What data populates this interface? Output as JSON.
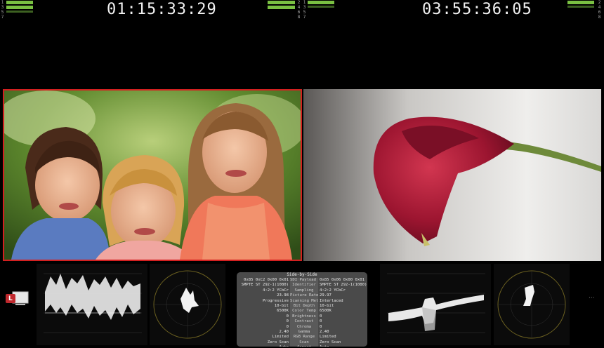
{
  "timecodes": {
    "left": "01:15:33:29",
    "right": "03:55:36:05"
  },
  "meter_channels": [
    "1",
    "3",
    "5",
    "7"
  ],
  "meter_channels_b": [
    "2",
    "4",
    "6",
    "8"
  ],
  "colors": {
    "meter": "#7ac142",
    "selection": "#d32020",
    "panel": "#4a4a4a"
  },
  "display_icon": {
    "label": "L"
  },
  "info_panel": {
    "title": "Side-by-Side",
    "rows": [
      {
        "left": "0x85 0xC2 0x00 0x01",
        "label": "SDI Payload ID",
        "right": "0x85 0x06 0x00 0x01"
      },
      {
        "left": "SMPTE ST 292-1(1080)",
        "label": "Identifier",
        "right": "SMPTE ST 292-1(1080)"
      },
      {
        "left": "4:2:2 YCbCr",
        "label": "Sampling",
        "right": "4:2:2 YCbCr"
      },
      {
        "left": "23.98",
        "label": "Picture Rate",
        "right": "29.97"
      },
      {
        "left": "Progressive",
        "label": "Scanning Method",
        "right": "Interlaced"
      },
      {
        "left": "10-bit",
        "label": "Bit Depth",
        "right": "10-bit"
      },
      {
        "left": "6500K",
        "label": "Color Temp",
        "right": "6500K"
      },
      {
        "left": "0",
        "label": "Brightness",
        "right": "0"
      },
      {
        "left": "0",
        "label": "Contrast",
        "right": "0"
      },
      {
        "left": "0",
        "label": "Chroma",
        "right": "0"
      },
      {
        "left": "2.40",
        "label": "Gamma",
        "right": "2.40"
      },
      {
        "left": "Limited",
        "label": "RGB Range",
        "right": "Limited"
      },
      {
        "left": "Zero Scan",
        "label": "Scan",
        "right": "Zero Scan"
      },
      {
        "left": "Auto",
        "label": "Aspect",
        "right": "Auto"
      }
    ]
  }
}
